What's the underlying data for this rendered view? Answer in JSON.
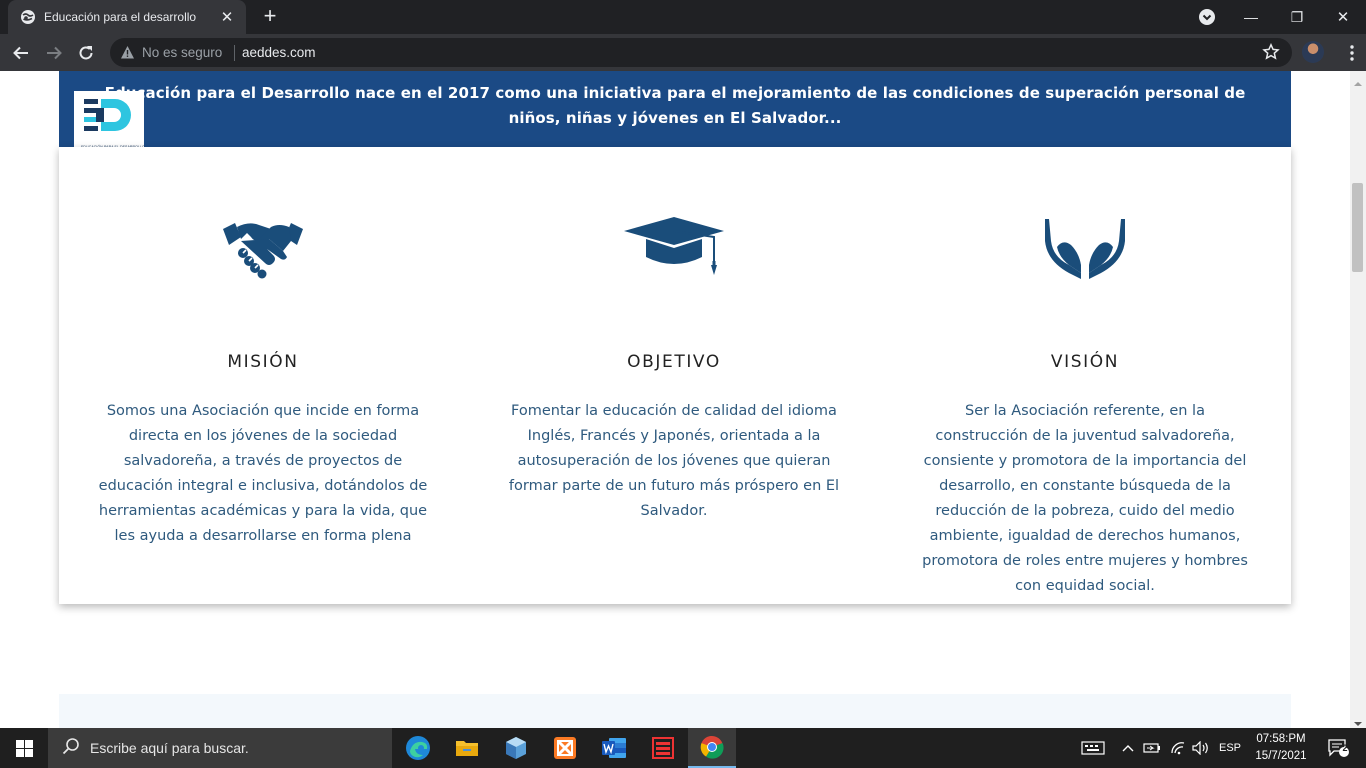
{
  "browser": {
    "tab_title": "Educación para el desarrollo",
    "tab_close": "✕",
    "new_tab": "+",
    "security_label": "No es seguro",
    "url": "aeddes.com",
    "window_controls": {
      "minimize": "—",
      "maximize": "❐",
      "close": "✕"
    }
  },
  "banner": {
    "text": "Educación para el Desarrollo nace en el 2017 como una iniciativa para el mejoramiento de las condiciones de superación personal de niños, niñas y jóvenes en El Salvador...",
    "logo_caption": "EDUCACIÓN PARA EL DESARROLLO"
  },
  "columns": [
    {
      "icon": "handshake-icon",
      "heading": "MISIÓN",
      "text": "Somos una Asociación que incide en forma directa en los jóvenes de la sociedad salvadoreña, a través de proyectos de educación integral e inclusiva, dotándolos de herramientas académicas y para la vida, que les ayuda a desarrollarse en forma plena"
    },
    {
      "icon": "graduation-cap-icon",
      "heading": "OBJETIVO",
      "text": "Fomentar la educación de calidad del idioma Inglés, Francés y Japonés, orientada a la autosuperación de los jóvenes que quieran formar parte de un futuro más próspero en El Salvador."
    },
    {
      "icon": "hands-icon",
      "heading": "VISIÓN",
      "text": "Ser la Asociación referente, en la construcción de la juventud salvadoreña, consiente y promotora de la importancia del desarrollo, en constante búsqueda de la reducción de la pobreza, cuido del medio ambiente, igualdad de derechos humanos, promotora de roles entre mujeres y hombres con equidad social."
    }
  ],
  "taskbar": {
    "search_placeholder": "Escribe aquí para buscar.",
    "language": "ESP",
    "time": "07:58:PM",
    "date": "15/7/2021",
    "notification_count": "2"
  },
  "colors": {
    "brand_blue": "#1b4a85",
    "icon_blue": "#1a4d7a",
    "text_blue": "#2f5a7e",
    "logo_cyan": "#2ec5e0"
  }
}
